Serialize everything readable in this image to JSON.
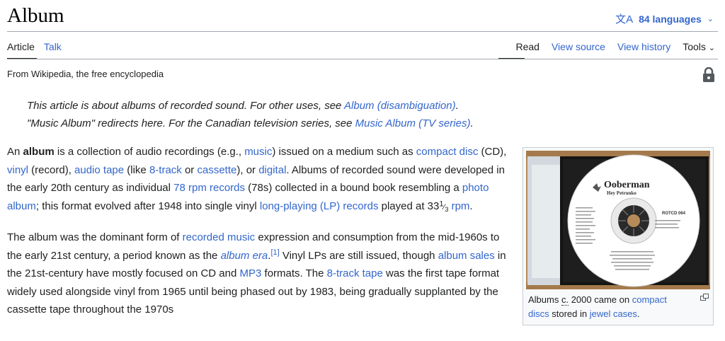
{
  "page": {
    "title": "Album",
    "languages_label": "84 languages",
    "tagline": "From Wikipedia, the free encyclopedia"
  },
  "tabs_left": [
    "Article",
    "Talk"
  ],
  "tabs_right": [
    "Read",
    "View source",
    "View history",
    "Tools"
  ],
  "hatnote": {
    "line1_prefix": "This article is about albums of recorded sound. For other uses, see ",
    "line1_link": "Album (disambiguation)",
    "line1_suffix": ".",
    "line2_prefix": "\"Music Album\" redirects here. For the Canadian television series, see ",
    "line2_link": "Music Album (TV series)",
    "line2_suffix": "."
  },
  "para1": {
    "t1": "An ",
    "bold": "album",
    "t2": " is a collection of audio recordings (e.g., ",
    "l_music": "music",
    "t3": ") issued on a medium such as ",
    "l_cd": "compact disc",
    "t4": " (CD), ",
    "l_vinyl": "vinyl",
    "t5": " (record), ",
    "l_tape": "audio tape",
    "t6": " (like ",
    "l_8track": "8-track",
    "t7": " or ",
    "l_cassette": "cassette",
    "t8": "), or ",
    "l_digital": "digital",
    "t9": ". Albums of recorded sound were developed in the early 20th century as individual ",
    "l_78": "78 rpm records",
    "t10": " (78s) collected in a bound book resembling a ",
    "l_photo": "photo album",
    "t11": "; this format evolved after 1948 into single vinyl ",
    "l_lp": "long-playing (LP) records",
    "t12": " played at 33",
    "frac_num": "1",
    "frac_den": "3",
    "t13": " ",
    "l_rpm": "rpm",
    "t14": "."
  },
  "para2": {
    "t1": "The album was the dominant form of ",
    "l_recorded": "recorded music",
    "t2": " expression and consumption from the mid-1960s to the early 21st century, a period known as the ",
    "l_era": "album era",
    "ref": "[1]",
    "t3": " Vinyl LPs are still issued, though ",
    "l_sales": "album sales",
    "t4": " in the 21st-century have mostly focused on CD and ",
    "l_mp3": "MP3",
    "t5": " formats. The ",
    "l_8tt": "8-track tape",
    "t6": " was the first tape format widely used alongside vinyl from 1965 until being phased out by 1983, being gradually supplanted by the cassette tape throughout the 1970s"
  },
  "infobox": {
    "caption_t1": "Albums ",
    "caption_abbr": "c.",
    "caption_t2": " 2000 came on ",
    "caption_l1": "compact discs",
    "caption_t3": " stored in ",
    "caption_l2": "jewel cases",
    "caption_t4": ".",
    "disc_title": "Ooberman",
    "disc_subtitle": "Hey Petrunko",
    "disc_code": "ROTCD 064"
  }
}
